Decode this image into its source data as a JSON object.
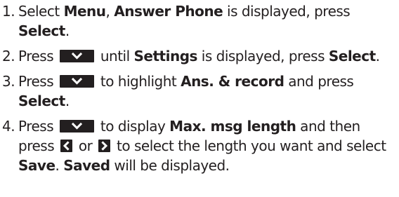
{
  "steps": [
    {
      "number": "1.",
      "segments": [
        {
          "t": "Select ",
          "b": false
        },
        {
          "t": "Menu",
          "b": true
        },
        {
          "t": ", ",
          "b": false
        },
        {
          "t": "Answer Phone",
          "b": true
        },
        {
          "t": " is displayed, press ",
          "b": false
        },
        {
          "t": "Select",
          "b": true
        },
        {
          "t": ".",
          "b": false
        }
      ]
    },
    {
      "number": "2.",
      "segments": [
        {
          "t": "Press ",
          "b": false
        },
        {
          "key": "down"
        },
        {
          "t": " until ",
          "b": false
        },
        {
          "t": "Settings",
          "b": true
        },
        {
          "t": " is displayed, press ",
          "b": false
        },
        {
          "t": "Select",
          "b": true
        },
        {
          "t": ".",
          "b": false
        }
      ]
    },
    {
      "number": "3.",
      "segments": [
        {
          "t": "Press ",
          "b": false
        },
        {
          "key": "down"
        },
        {
          "t": " to highlight ",
          "b": false
        },
        {
          "t": "Ans. & record",
          "b": true
        },
        {
          "t": " and press ",
          "b": false
        },
        {
          "t": "Select",
          "b": true
        },
        {
          "t": ".",
          "b": false
        }
      ]
    },
    {
      "number": "4.",
      "segments": [
        {
          "t": "Press ",
          "b": false
        },
        {
          "key": "down"
        },
        {
          "t": " to display ",
          "b": false
        },
        {
          "t": "Max. msg length",
          "b": true
        },
        {
          "t": " and then press ",
          "b": false
        },
        {
          "key": "left"
        },
        {
          "t": " or ",
          "b": false
        },
        {
          "key": "right"
        },
        {
          "t": " to select the length you want and select ",
          "b": false
        },
        {
          "t": "Save",
          "b": true
        },
        {
          "t": ". ",
          "b": false
        },
        {
          "t": "Saved",
          "b": true
        },
        {
          "t": " will be displayed.",
          "b": false
        }
      ]
    }
  ],
  "icons": {
    "down": "down-arrow-key-icon",
    "left": "left-arrow-key-icon",
    "right": "right-arrow-key-icon"
  },
  "colors": {
    "text": "#231f20",
    "key_background": "#231f20",
    "key_glyph": "#ffffff"
  }
}
